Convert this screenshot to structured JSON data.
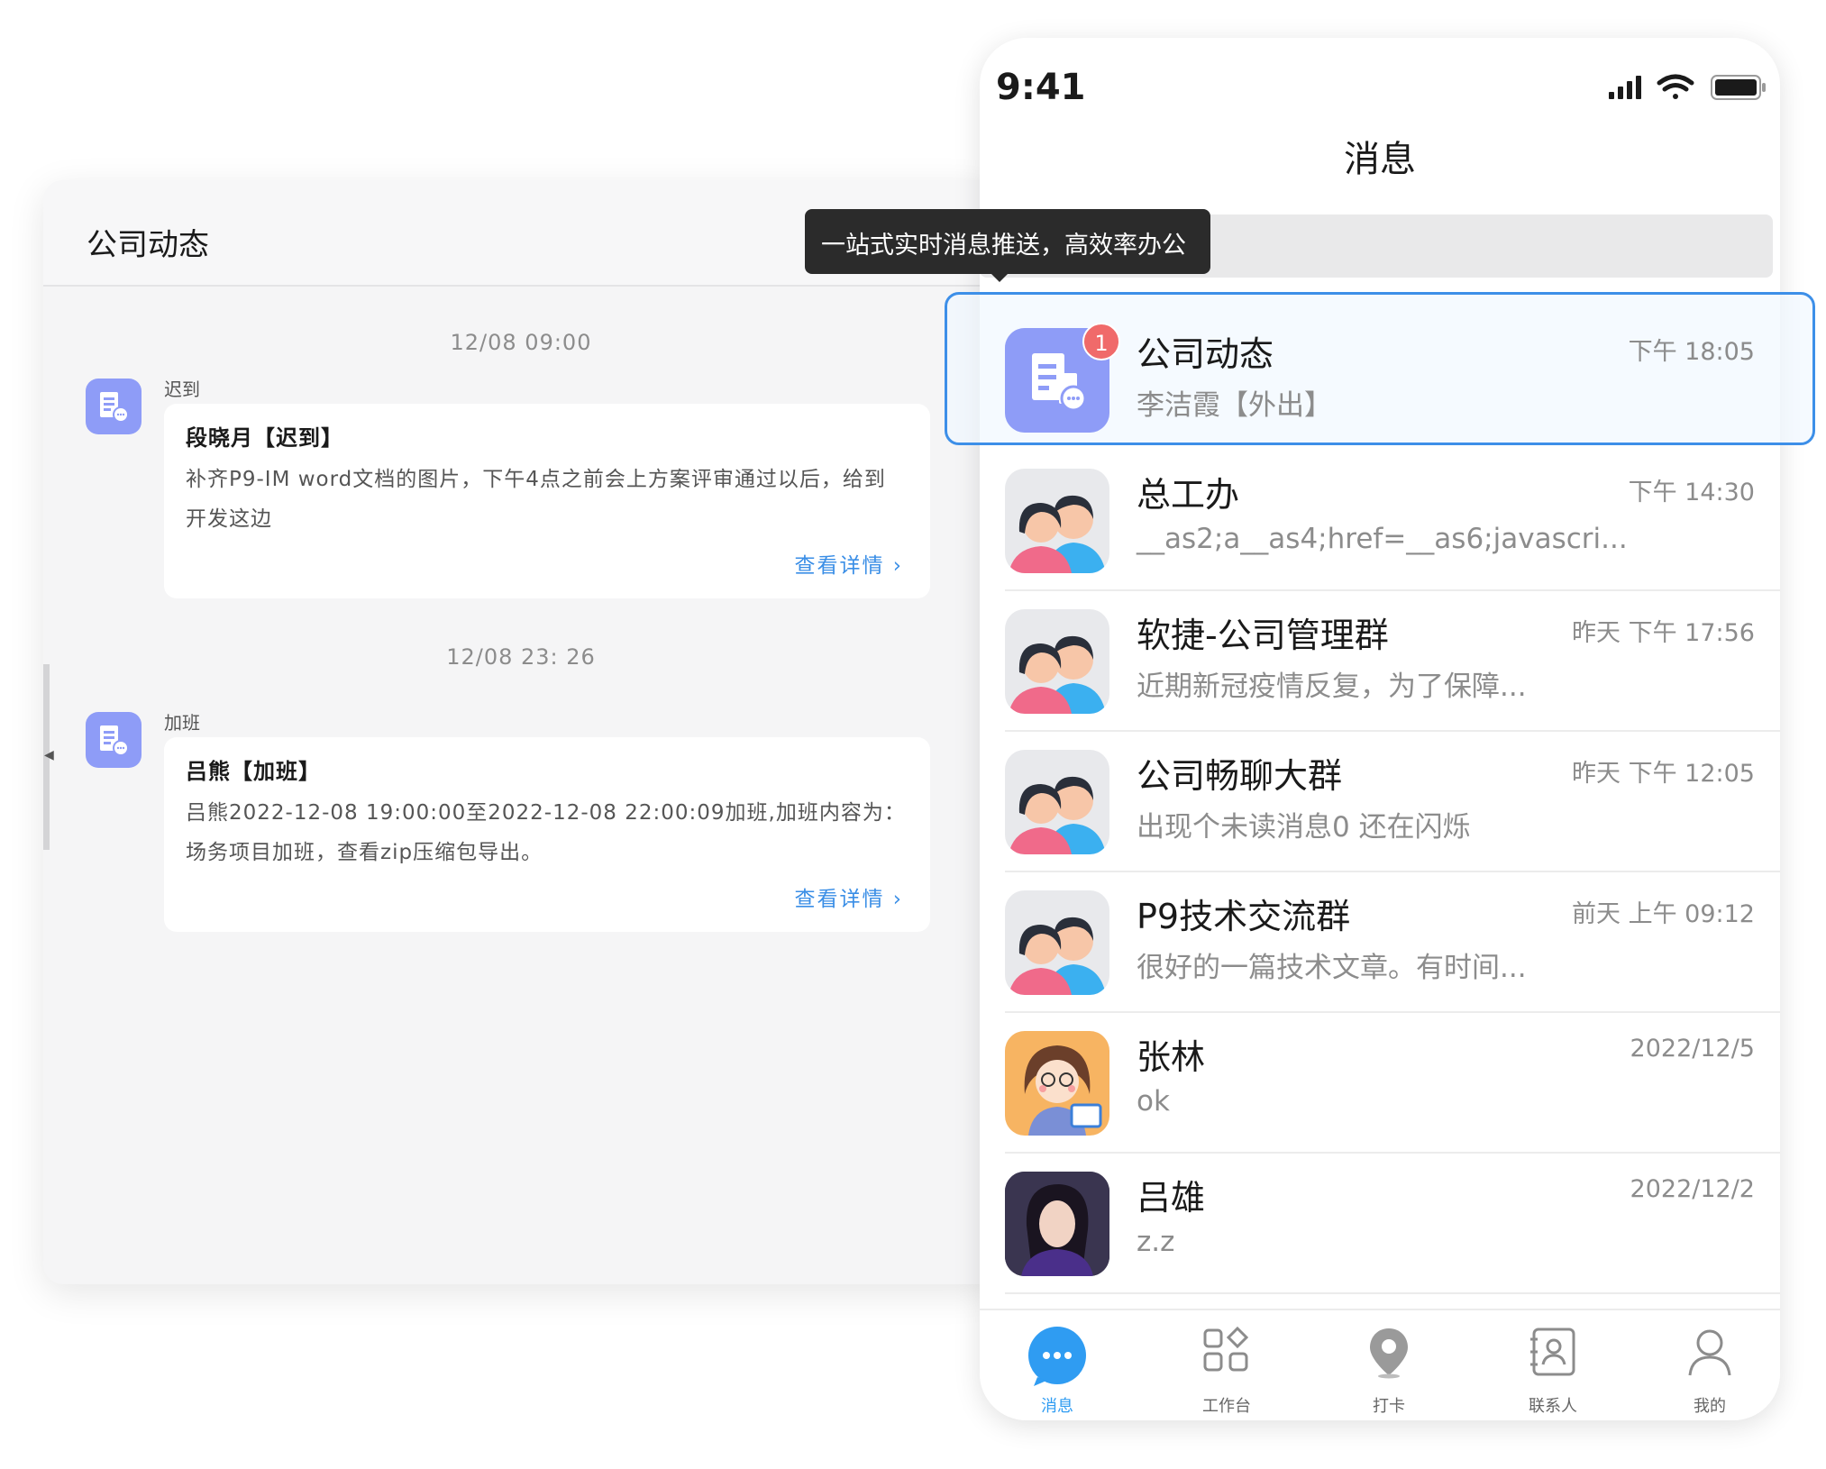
{
  "left": {
    "title": "公司动态",
    "entries": [
      {
        "timestamp": "12/08 09:00",
        "category": "迟到",
        "card_title": "段晓月【迟到】",
        "card_body": "补齐P9-IM word文档的图片，下午4点之前会上方案评审通过以后，给到开发这边",
        "link": "查看详情 ›"
      },
      {
        "timestamp": "12/08 23: 26",
        "category": "加班",
        "card_title": "吕熊【加班】",
        "card_body": "吕熊2022-12-08 19:00:00至2022-12-08 22:00:09加班,加班内容为：场务项目加班，查看zip压缩包导出。",
        "link": "查看详情 ›"
      }
    ]
  },
  "tooltip": "一站式实时消息推送，高效率办公",
  "phone": {
    "status_time": "9:41",
    "title": "消息",
    "conversations": [
      {
        "name": "公司动态",
        "time": "下午 18:05",
        "preview": "李洁霞【外出】",
        "badge": "1",
        "avatar": "company-app-icon"
      },
      {
        "name": "总工办",
        "time": "下午 14:30",
        "preview": "__as2;a__as4;href=__as6;javascri...",
        "avatar": "group-avatar-icon"
      },
      {
        "name": "软捷-公司管理群",
        "time": "昨天 下午 17:56",
        "preview": "近期新冠疫情反复，为了保障...",
        "avatar": "group-avatar-icon"
      },
      {
        "name": "公司畅聊大群",
        "time": "昨天 下午 12:05",
        "preview": "出现个未读消息0 还在闪烁",
        "avatar": "group-avatar-icon"
      },
      {
        "name": "P9技术交流群",
        "time": "前天 上午 09:12",
        "preview": "很好的一篇技术文章。有时间...",
        "avatar": "group-avatar-icon"
      },
      {
        "name": "张林",
        "time": "2022/12/5",
        "preview": "ok",
        "avatar": "cartoon-girl-avatar"
      },
      {
        "name": "吕雄",
        "time": "2022/12/2",
        "preview": "z.z",
        "avatar": "photo-avatar"
      }
    ],
    "tabs": [
      {
        "label": "消息",
        "icon": "message-icon",
        "active": true
      },
      {
        "label": "工作台",
        "icon": "workbench-icon",
        "active": false
      },
      {
        "label": "打卡",
        "icon": "location-pin-icon",
        "active": false
      },
      {
        "label": "联系人",
        "icon": "contacts-icon",
        "active": false
      },
      {
        "label": "我的",
        "icon": "user-icon",
        "active": false
      }
    ]
  },
  "colors": {
    "accent": "#3d8fe8",
    "badge": "#f06a6a",
    "app_icon": "#8e9cf7",
    "link": "#3a8ee6"
  }
}
